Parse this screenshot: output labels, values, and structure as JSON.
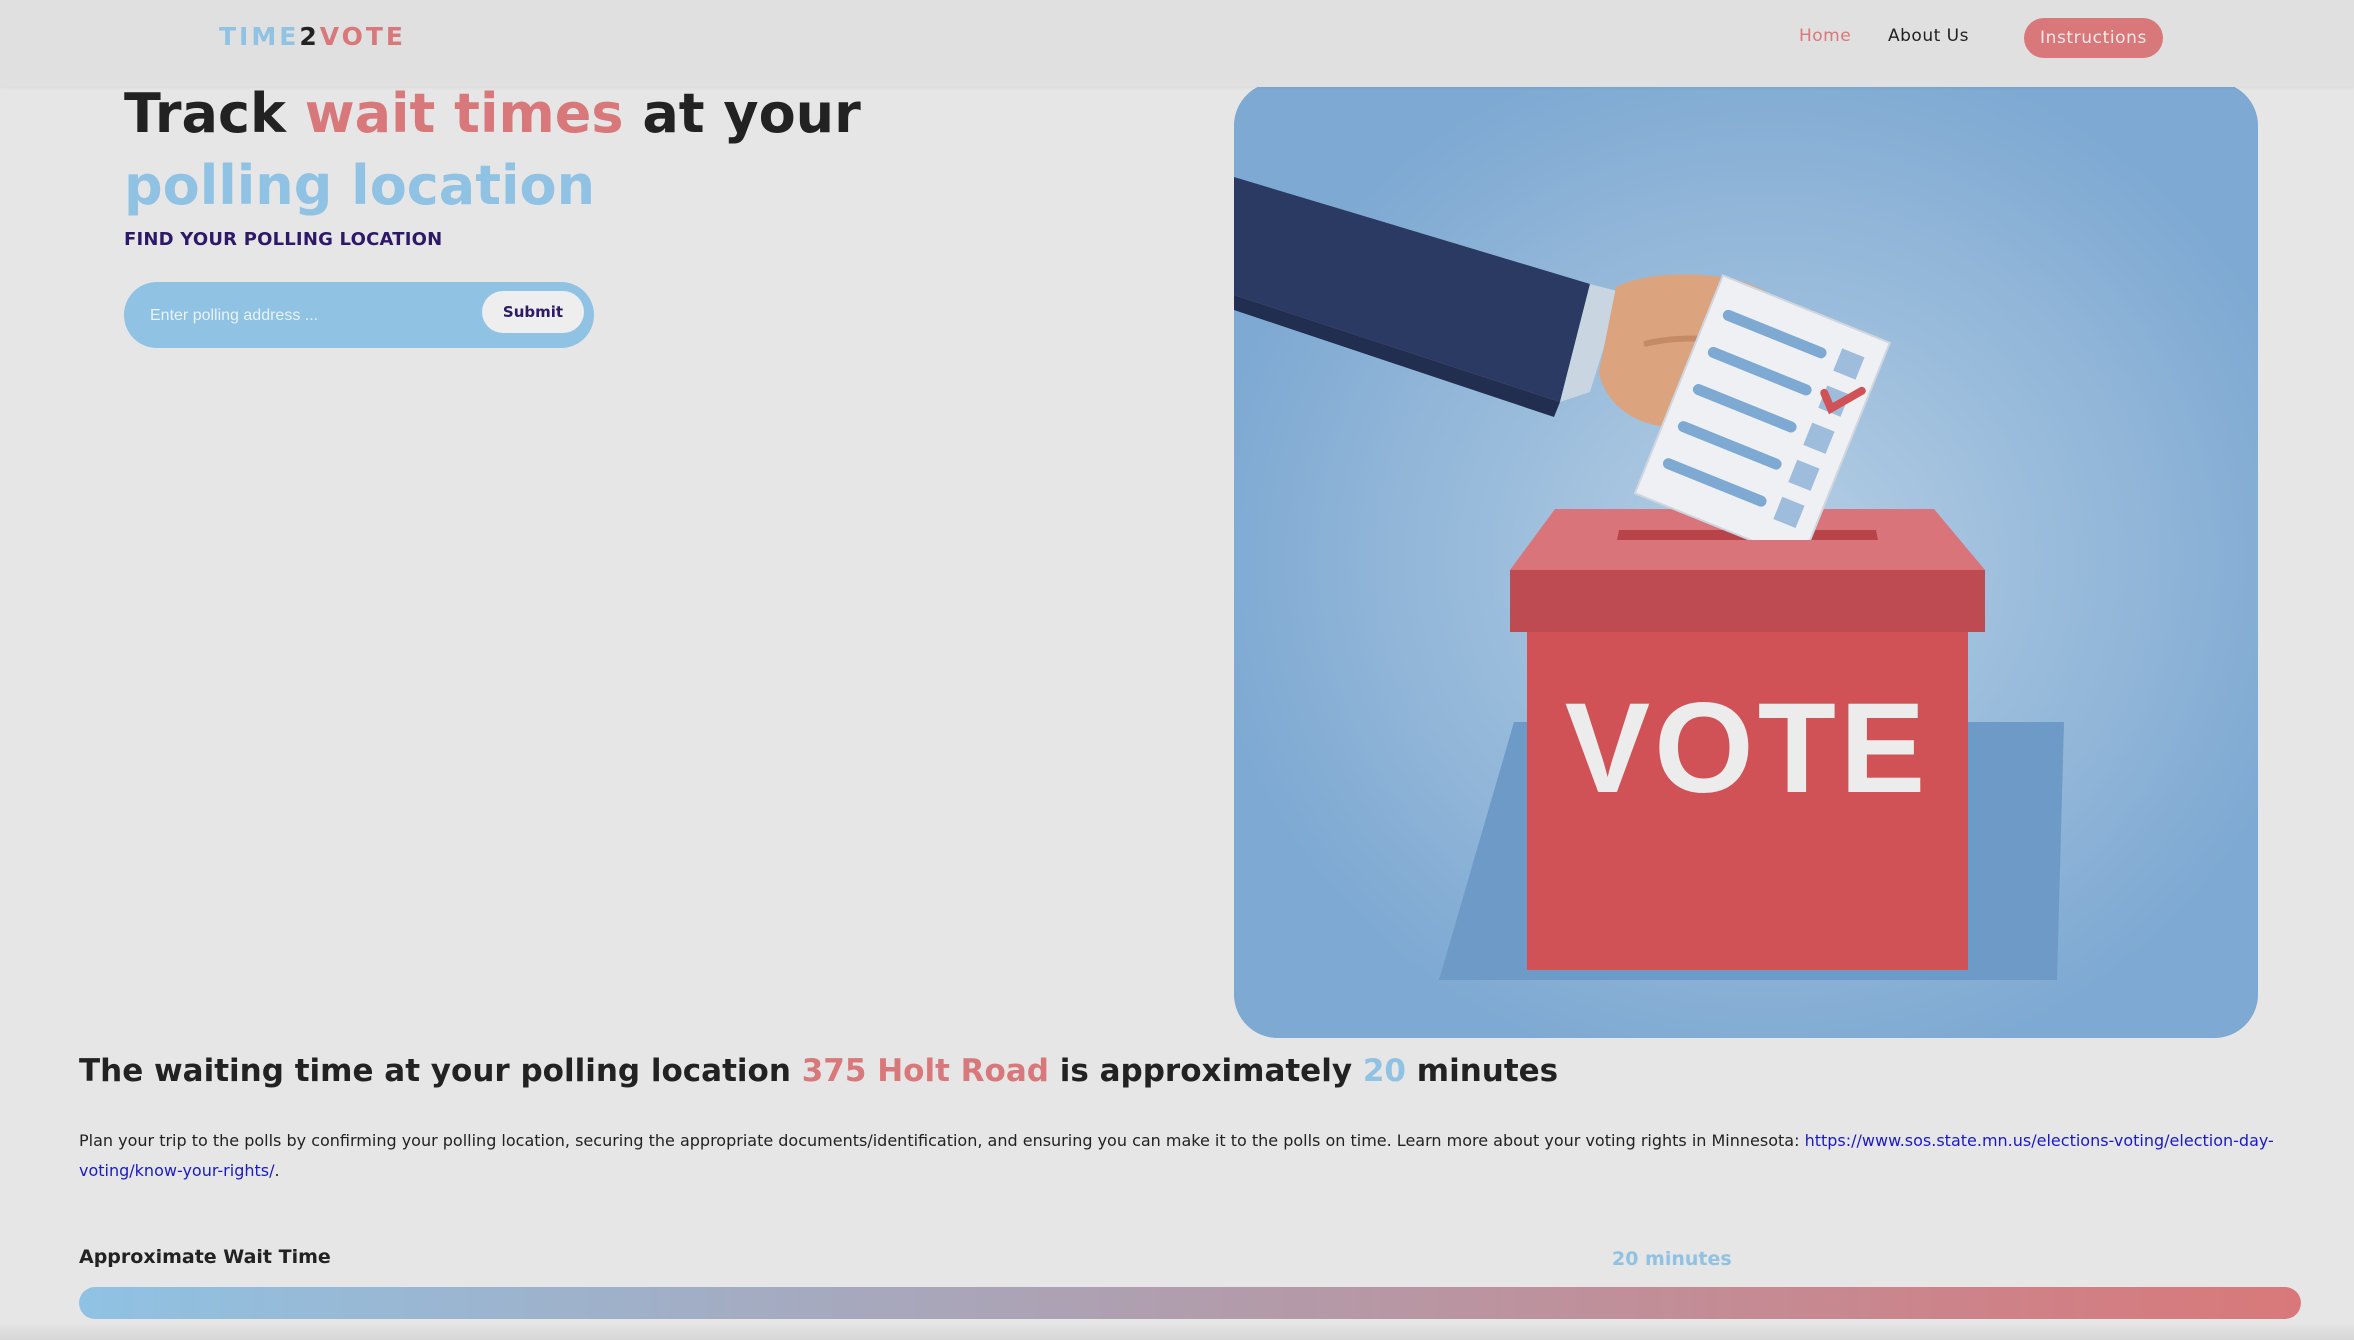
{
  "nav": {
    "logo": {
      "part1": "TIME",
      "part2": "2",
      "part3": "VOTE"
    },
    "links": [
      {
        "label": "Home"
      },
      {
        "label": "About Us"
      }
    ],
    "instructions_button": "Instructions"
  },
  "hero": {
    "title": {
      "t1": "Track ",
      "t2": "wait times",
      "t3": " at your ",
      "t4": "polling location"
    },
    "find_label": "FIND YOUR POLLING LOCATION",
    "search": {
      "placeholder": "Enter polling address ...",
      "value": "",
      "submit_label": "Submit"
    },
    "illustration": {
      "box_text": "VOTE"
    }
  },
  "result": {
    "prefix": "The waiting time at your polling location ",
    "location": "375 Holt Road",
    "middle": " is approximately ",
    "minutes": "20",
    "suffix": " minutes"
  },
  "info": {
    "text": "Plan your trip to the polls by confirming your polling location, securing the appropriate documents/identification, and ensuring you can make it to the polls on time. Learn more about your voting rights in Minnesota: ",
    "link": "https://www.sos.state.mn.us/elections-voting/election-day-voting/know-your-rights/",
    "end": "."
  },
  "wait": {
    "label": "Approximate Wait Time",
    "value_text": "20 minutes",
    "progress_percent": 100
  },
  "colors": {
    "accent_red": "#d9787a",
    "accent_blue": "#8fc2e3",
    "navy": "#2e1968"
  },
  "icons": [
    "ballot-box-illustration"
  ]
}
